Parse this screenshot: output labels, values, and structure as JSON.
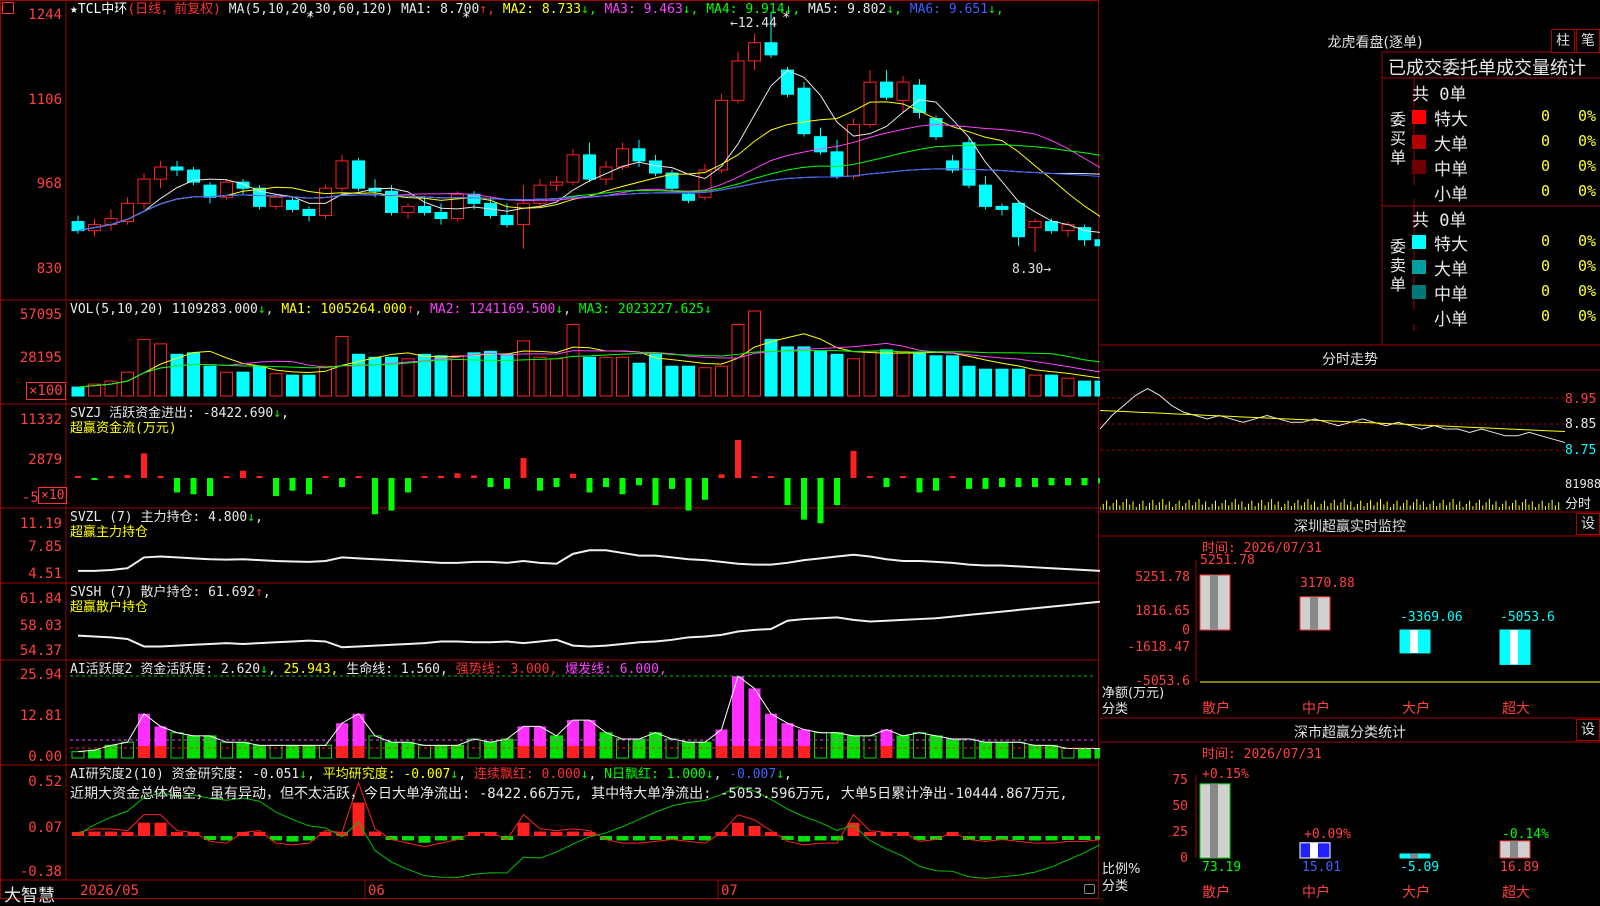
{
  "title": {
    "star": "★",
    "name": "TCL中环",
    "mode": "(日线，前复权)"
  },
  "main_header": {
    "ma_spec": "MA(5,10,20,30,60,120)",
    "items": [
      {
        "label": "MA1:",
        "value": "8.700",
        "arrow": "↑",
        "color": "#e8e8e8"
      },
      {
        "label": "MA2:",
        "value": "8.733",
        "arrow": "↓",
        "color": "#ffff00"
      },
      {
        "label": "MA3:",
        "value": "9.463",
        "arrow": "↓",
        "color": "#ff40ff"
      },
      {
        "label": "MA4:",
        "value": "9.914",
        "arrow": "↓",
        "color": "#00ff00"
      },
      {
        "label": "MA5:",
        "value": "9.802",
        "arrow": "↓",
        "color": "#e8e8e8"
      },
      {
        "label": "MA6:",
        "value": "9.651",
        "arrow": "↓",
        "color": "#4060ff"
      }
    ]
  },
  "price_axis": [
    "1244",
    "1106",
    "968",
    "830"
  ],
  "high_label": "12.44",
  "low_label": "8.30→",
  "vol_header": {
    "spec": "VOL(5,10,20)",
    "value": "1109283.000",
    "ma1": "MA1: 1005264.000",
    "ma2": "MA2: 1241169.500",
    "ma3": "MA3: 2023227.625"
  },
  "vol_axis": [
    "57095",
    "28195",
    "×100"
  ],
  "svzj": {
    "line1": "SVZJ  活跃资金进出: -8422.690",
    "line2": "超赢资金流(万元)",
    "axis": [
      "11332",
      "2879",
      "-5",
      "×10"
    ]
  },
  "svzl": {
    "line1": "SVZL (7) 主力持仓: 4.800",
    "line2": "超赢主力持仓",
    "axis": [
      "11.19",
      "7.85",
      "4.51"
    ]
  },
  "svsh": {
    "line1": "SVSH (7) 散户持仓: 61.692",
    "line2": "超赢散户持仓",
    "axis": [
      "61.84",
      "58.03",
      "54.37"
    ]
  },
  "ai_active": {
    "label": "AI活跃度2",
    "a": "资金活跃度: 2.620",
    "b": "25.943,",
    "c": "生命线: 1.560,",
    "d": "强势线: 3.000,",
    "e": "爆发线: 6.000,",
    "axis": [
      "25.94",
      "12.81",
      "0.00"
    ]
  },
  "ai_research": {
    "label": "AI研究度2(10)",
    "a": "资金研究度: -0.051",
    "b": "平均研究度: -0.007",
    "c": "连续飘红: 0.000",
    "d": "N日飘红: 1.000",
    "e": "-0.007",
    "text": "近期大资金总体偏空，虽有异动，但不太活跃，今日大单净流出: -8422.66万元, 其中特大单净流出: -5053.596万元, 大单5日累计净出-10444.867万元,",
    "axis": [
      "0.52",
      "0.07",
      "-0.38"
    ]
  },
  "date_axis": [
    "2026/05",
    "06",
    "07"
  ],
  "brand": "大智慧",
  "right": {
    "dragon_title": "龙虎看盘(逐单)",
    "btn_zhu": "柱",
    "btn_bi": "笔",
    "stat_title": "已成交委托单成交量统计",
    "buy_label": "委买单",
    "sell_label": "委卖单",
    "buy_total": "共 0单",
    "sell_total": "共 0单",
    "buy_rows": [
      {
        "name": "特大",
        "count": "0",
        "pct": "0%",
        "color": "#ff0000"
      },
      {
        "name": "大单",
        "count": "0",
        "pct": "0%",
        "color": "#b00000"
      },
      {
        "name": "中单",
        "count": "0",
        "pct": "0%",
        "color": "#700000"
      },
      {
        "name": "小单",
        "count": "0",
        "pct": "0%",
        "color": "#000000"
      }
    ],
    "sell_rows": [
      {
        "name": "特大",
        "count": "0",
        "pct": "0%",
        "color": "#00ffff"
      },
      {
        "name": "大单",
        "count": "0",
        "pct": "0%",
        "color": "#00a0a0"
      },
      {
        "name": "中单",
        "count": "0",
        "pct": "0%",
        "color": "#007878"
      },
      {
        "name": "小单",
        "count": "0",
        "pct": "0%",
        "color": "#000000"
      }
    ],
    "intraday_title": "分时走势",
    "intraday_axis": [
      "8.95",
      "8.85",
      "8.75",
      "81988",
      "分时"
    ],
    "monitor_title": "深圳超赢实时监控",
    "monitor_time": "时间: 2026/07/31",
    "monitor_axis": [
      "5251.78",
      "1816.65",
      "0",
      "-1618.47",
      "-5053.6"
    ],
    "monitor_ylabel": "净额(万元)",
    "cat_label": "分类",
    "categories": [
      "散户",
      "中户",
      "大户",
      "超大"
    ],
    "monitor_value_labels": [
      "5251.78",
      "3170.88",
      "-3369.06",
      "-5053.6"
    ],
    "class_title": "深市超赢分类统计",
    "class_time": "时间: 2026/07/31",
    "class_axis": [
      "75",
      "50",
      "25",
      "0"
    ],
    "class_ylabel": "比例%",
    "class_top_labels": [
      "+0.15%",
      "+0.09%",
      "-0.14%"
    ],
    "class_bottom_labels": [
      "73.19",
      "15.01",
      "-5.09",
      "16.89"
    ],
    "settings": "设"
  },
  "chart_data": [
    {
      "type": "candlestick",
      "ylim": [
        8.0,
        12.6
      ],
      "ticks": [
        12.44,
        11.06,
        9.68,
        8.3
      ],
      "ohlc": [
        [
          9.0,
          9.1,
          8.8,
          8.85
        ],
        [
          8.85,
          9.05,
          8.75,
          8.95
        ],
        [
          8.95,
          9.2,
          8.85,
          9.05
        ],
        [
          9.0,
          9.4,
          8.95,
          9.3
        ],
        [
          9.3,
          9.8,
          9.2,
          9.7
        ],
        [
          9.7,
          10.0,
          9.55,
          9.9
        ],
        [
          9.9,
          10.0,
          9.75,
          9.85
        ],
        [
          9.85,
          9.9,
          9.6,
          9.65
        ],
        [
          9.6,
          9.65,
          9.3,
          9.4
        ],
        [
          9.4,
          9.7,
          9.35,
          9.65
        ],
        [
          9.65,
          9.7,
          9.45,
          9.55
        ],
        [
          9.55,
          9.6,
          9.2,
          9.25
        ],
        [
          9.25,
          9.45,
          9.2,
          9.4
        ],
        [
          9.35,
          9.4,
          9.15,
          9.2
        ],
        [
          9.2,
          9.25,
          9.0,
          9.1
        ],
        [
          9.1,
          9.6,
          9.05,
          9.55
        ],
        [
          9.55,
          10.1,
          9.5,
          10.0
        ],
        [
          10.0,
          10.05,
          9.5,
          9.55
        ],
        [
          9.55,
          9.7,
          9.4,
          9.5
        ],
        [
          9.5,
          9.6,
          9.1,
          9.15
        ],
        [
          9.15,
          9.3,
          9.05,
          9.25
        ],
        [
          9.25,
          9.4,
          9.1,
          9.15
        ],
        [
          9.15,
          9.3,
          8.95,
          9.05
        ],
        [
          9.05,
          9.5,
          9.0,
          9.45
        ],
        [
          9.45,
          9.5,
          9.2,
          9.3
        ],
        [
          9.3,
          9.4,
          9.05,
          9.1
        ],
        [
          9.1,
          9.3,
          8.9,
          8.95
        ],
        [
          8.95,
          9.6,
          8.55,
          9.3
        ],
        [
          9.3,
          9.7,
          9.25,
          9.6
        ],
        [
          9.6,
          9.75,
          9.5,
          9.65
        ],
        [
          9.65,
          10.2,
          9.6,
          10.1
        ],
        [
          10.1,
          10.3,
          9.65,
          9.7
        ],
        [
          9.7,
          10.0,
          9.6,
          9.9
        ],
        [
          9.9,
          10.3,
          9.85,
          10.2
        ],
        [
          10.2,
          10.35,
          9.9,
          10.0
        ],
        [
          10.0,
          10.1,
          9.75,
          9.8
        ],
        [
          9.8,
          9.85,
          9.5,
          9.55
        ],
        [
          9.45,
          9.5,
          9.3,
          9.35
        ],
        [
          9.4,
          9.95,
          9.35,
          9.85
        ],
        [
          9.85,
          11.1,
          9.8,
          11.0
        ],
        [
          11.0,
          11.8,
          10.95,
          11.65
        ],
        [
          11.65,
          12.1,
          11.5,
          11.95
        ],
        [
          11.95,
          12.44,
          11.7,
          11.75
        ],
        [
          11.5,
          11.55,
          11.05,
          11.1
        ],
        [
          11.2,
          11.3,
          10.4,
          10.45
        ],
        [
          10.4,
          10.55,
          10.1,
          10.15
        ],
        [
          10.15,
          10.35,
          9.7,
          9.75
        ],
        [
          9.75,
          10.7,
          9.7,
          10.6
        ],
        [
          10.6,
          11.5,
          10.55,
          11.3
        ],
        [
          11.3,
          11.5,
          11.0,
          11.05
        ],
        [
          11.0,
          11.4,
          10.8,
          11.3
        ],
        [
          11.25,
          11.35,
          10.7,
          10.8
        ],
        [
          10.7,
          10.75,
          10.35,
          10.4
        ],
        [
          10.0,
          10.1,
          9.8,
          9.85
        ],
        [
          10.3,
          10.4,
          9.55,
          9.6
        ],
        [
          9.6,
          9.75,
          9.2,
          9.25
        ],
        [
          9.25,
          9.3,
          9.1,
          9.2
        ],
        [
          9.3,
          9.35,
          8.6,
          8.75
        ],
        [
          8.9,
          9.05,
          8.5,
          9.0
        ],
        [
          9.0,
          9.05,
          8.8,
          8.85
        ],
        [
          8.85,
          9.0,
          8.75,
          8.95
        ],
        [
          8.9,
          8.95,
          8.6,
          8.7
        ],
        [
          8.7,
          8.8,
          8.3,
          8.6
        ],
        [
          8.6,
          8.75,
          8.3,
          8.55
        ],
        [
          8.55,
          8.75,
          8.4,
          8.7
        ],
        [
          8.7,
          8.95,
          8.6,
          8.9
        ],
        [
          8.9,
          9.1,
          8.85,
          9.05
        ]
      ]
    },
    {
      "type": "bar",
      "name": "VOL",
      "ylim": [
        0,
        60000
      ],
      "ticks": [
        57095,
        28195
      ],
      "values": [
        6000,
        8000,
        10000,
        16000,
        38000,
        35000,
        28000,
        29000,
        20000,
        16000,
        16000,
        20000,
        15000,
        14000,
        14000,
        20000,
        40000,
        28000,
        26000,
        26000,
        25000,
        28000,
        27000,
        27000,
        29000,
        30000,
        28000,
        37000,
        26000,
        25000,
        48000,
        26000,
        26000,
        26000,
        22000,
        28000,
        20000,
        20000,
        19000,
        20000,
        48000,
        57095,
        38000,
        33000,
        33000,
        30000,
        28000,
        25000,
        30000,
        31000,
        30000,
        29000,
        27000,
        27000,
        20000,
        18000,
        18000,
        18000,
        14000,
        14000,
        12000,
        10000,
        10000,
        9000,
        10000,
        11000,
        10000
      ]
    },
    {
      "type": "bar",
      "name": "SVZJ",
      "ylim": [
        -500,
        11332
      ],
      "ticks": [
        11332,
        2879,
        -5
      ],
      "values": [
        200,
        0,
        300,
        800,
        6800,
        200,
        -800,
        -900,
        -1000,
        200,
        2000,
        300,
        -1000,
        -700,
        -900,
        300,
        -500,
        500,
        -2000,
        -1800,
        -800,
        500,
        600,
        1300,
        700,
        -500,
        -600,
        5500,
        -700,
        -500,
        1200,
        -800,
        -500,
        -900,
        -400,
        -1500,
        -600,
        -1800,
        -1200,
        1000,
        10500,
        300,
        300,
        -1500,
        -2300,
        -2500,
        -1500,
        7500,
        300,
        -500,
        200,
        -800,
        -700,
        400,
        -600,
        -600,
        -500,
        -500,
        -500,
        -400,
        -400,
        -400,
        -300,
        -300,
        -300,
        500,
        -300
      ]
    },
    {
      "type": "line",
      "name": "SVZL",
      "ylim": [
        4.51,
        11.19
      ],
      "ticks": [
        11.19,
        7.85,
        4.51
      ],
      "values": [
        5.3,
        5.3,
        5.4,
        5.6,
        6.8,
        6.9,
        6.8,
        6.7,
        6.6,
        6.55,
        6.6,
        6.5,
        6.4,
        6.35,
        6.3,
        6.4,
        6.8,
        6.7,
        6.6,
        6.5,
        6.4,
        6.3,
        6.2,
        6.2,
        6.3,
        6.3,
        6.2,
        6.4,
        6.2,
        6.1,
        7.2,
        7.6,
        7.6,
        7.3,
        7.0,
        7.0,
        6.8,
        6.6,
        6.5,
        6.3,
        6.1,
        6.0,
        6.0,
        6.2,
        6.5,
        6.7,
        6.9,
        7.1,
        6.9,
        6.6,
        6.4,
        6.4,
        6.3,
        6.2,
        6.0,
        5.9,
        5.9,
        5.8,
        5.7,
        5.6,
        5.5,
        5.4,
        5.3,
        5.2,
        5.2,
        5.2,
        5.2
      ]
    },
    {
      "type": "line",
      "name": "SVSH",
      "ylim": [
        54.37,
        61.84
      ],
      "ticks": [
        61.84,
        58.03,
        54.37
      ],
      "values": [
        56.7,
        56.6,
        56.5,
        56.3,
        55.4,
        55.4,
        55.5,
        55.6,
        55.7,
        55.8,
        55.7,
        55.8,
        55.9,
        56.0,
        56.1,
        56.0,
        55.3,
        55.4,
        55.5,
        55.6,
        55.7,
        55.8,
        56.0,
        56.0,
        55.9,
        55.9,
        56.0,
        55.8,
        56.0,
        56.2,
        55.5,
        55.4,
        55.5,
        55.7,
        55.9,
        56.0,
        56.2,
        56.5,
        56.6,
        56.8,
        57.2,
        57.4,
        57.5,
        58.5,
        58.7,
        58.8,
        58.9,
        58.6,
        58.4,
        58.5,
        58.6,
        58.7,
        58.8,
        59.0,
        59.2,
        59.4,
        59.6,
        59.8,
        60.0,
        60.2,
        60.4,
        60.6,
        60.8,
        61.0,
        61.2,
        61.5,
        61.7
      ]
    },
    {
      "type": "bar",
      "name": "AI活跃度2",
      "ylim": [
        0,
        25.94
      ],
      "ticks": [
        25.94,
        12.81,
        0.0
      ],
      "values": [
        2,
        2.5,
        4,
        5,
        14,
        10,
        8,
        7,
        7,
        5,
        5,
        4,
        4,
        4,
        4,
        4,
        11,
        14,
        7,
        5,
        5,
        4,
        4,
        4,
        6,
        5,
        6,
        10,
        10,
        7,
        12,
        12,
        8,
        6,
        6,
        8,
        6,
        5,
        5,
        9,
        25.9,
        22,
        14,
        11,
        9,
        8,
        8,
        7,
        7,
        9,
        7,
        8,
        7,
        6,
        6,
        5,
        5,
        5,
        4,
        4,
        3,
        3,
        3,
        3,
        3,
        4,
        3
      ]
    },
    {
      "type": "bar",
      "name": "AI研究度2(10)",
      "ylim": [
        -0.38,
        0.52
      ],
      "ticks": [
        0.52,
        0.07,
        -0.38
      ],
      "values": [
        0.02,
        0.04,
        0.04,
        0.03,
        0.12,
        0.12,
        0.03,
        0.02,
        -0.03,
        -0.04,
        0.02,
        0.03,
        -0.04,
        -0.05,
        -0.04,
        0.03,
        0.02,
        0.3,
        0.04,
        -0.02,
        -0.04,
        -0.06,
        -0.04,
        -0.02,
        0.02,
        0.02,
        -0.02,
        0.12,
        0.04,
        0.03,
        0.04,
        0.03,
        -0.02,
        -0.04,
        -0.04,
        -0.03,
        -0.02,
        -0.03,
        -0.04,
        0.02,
        0.12,
        0.09,
        0.03,
        -0.03,
        -0.05,
        -0.04,
        -0.04,
        0.12,
        0.03,
        0.02,
        0.02,
        -0.03,
        -0.02,
        0.02,
        -0.02,
        -0.03,
        -0.02,
        -0.03,
        -0.04,
        -0.04,
        -0.03,
        -0.03,
        -0.02,
        -0.02,
        0.02,
        0.02,
        -0.03
      ]
    },
    {
      "type": "line",
      "name": "分时走势",
      "ylim": [
        8.7,
        9.0
      ],
      "ticks": [
        8.95,
        8.85,
        8.75
      ],
      "values": [
        8.86,
        8.9,
        8.93,
        8.96,
        8.98,
        8.96,
        8.93,
        8.91,
        8.9,
        8.89,
        8.9,
        8.89,
        8.88,
        8.89,
        8.9,
        8.89,
        8.88,
        8.88,
        8.89,
        8.88,
        8.87,
        8.88,
        8.89,
        8.88,
        8.87,
        8.88,
        8.87,
        8.86,
        8.87,
        8.86,
        8.86,
        8.85,
        8.86,
        8.85,
        8.84,
        8.84,
        8.85,
        8.84,
        8.83,
        8.82
      ]
    },
    {
      "type": "bar",
      "name": "深圳超赢实时监控",
      "categories": [
        "散户",
        "中户",
        "大户",
        "超大"
      ],
      "ylim": [
        -5053.6,
        5251.78
      ],
      "values": [
        5251.78,
        3170.88,
        -3369.06,
        -5053.6
      ]
    },
    {
      "type": "bar",
      "name": "深市超赢分类统计",
      "categories": [
        "散户",
        "中户",
        "大户",
        "超大"
      ],
      "ylim": [
        0,
        75
      ],
      "values": [
        73.19,
        15.01,
        -5.09,
        16.89
      ]
    }
  ],
  "colors": {
    "up": "#ff2020",
    "down": "#00ffff",
    "grid": "#a00000",
    "axis": "#ff4040"
  }
}
